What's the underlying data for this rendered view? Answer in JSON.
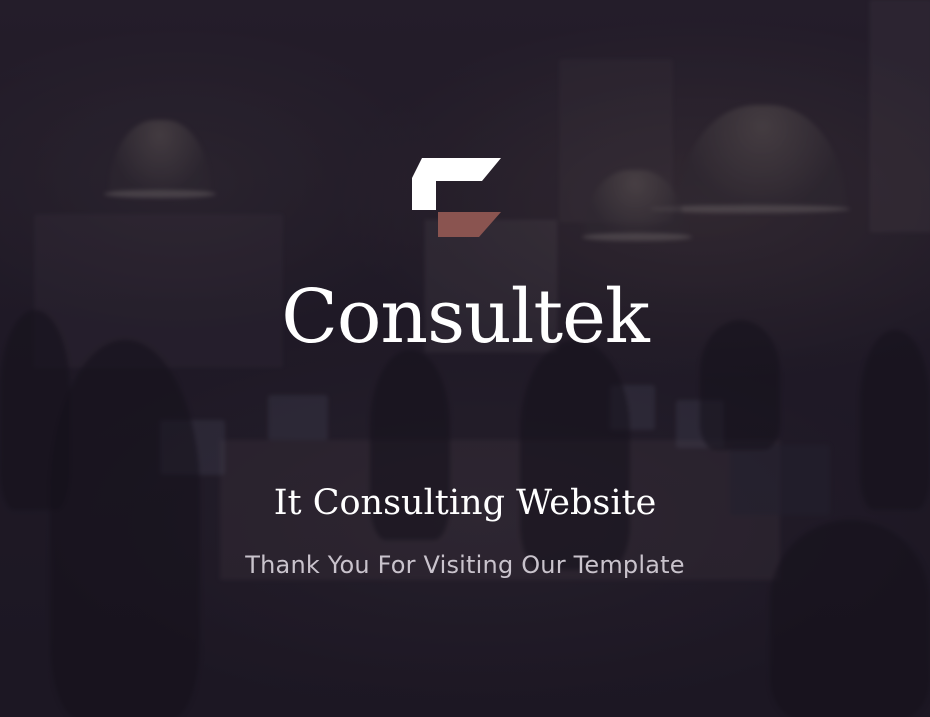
{
  "brand": {
    "name": "Consultek",
    "logo_icon": "consultek-logo-mark",
    "logo_colors": {
      "top": "#ffffff",
      "bottom": "#8a5450"
    }
  },
  "hero": {
    "headline": "It Consulting Website",
    "subheadline": "Thank You For Visiting Our Template",
    "background": "dark office meeting photo with purple overlay",
    "overlay_color": "#1d1925"
  }
}
